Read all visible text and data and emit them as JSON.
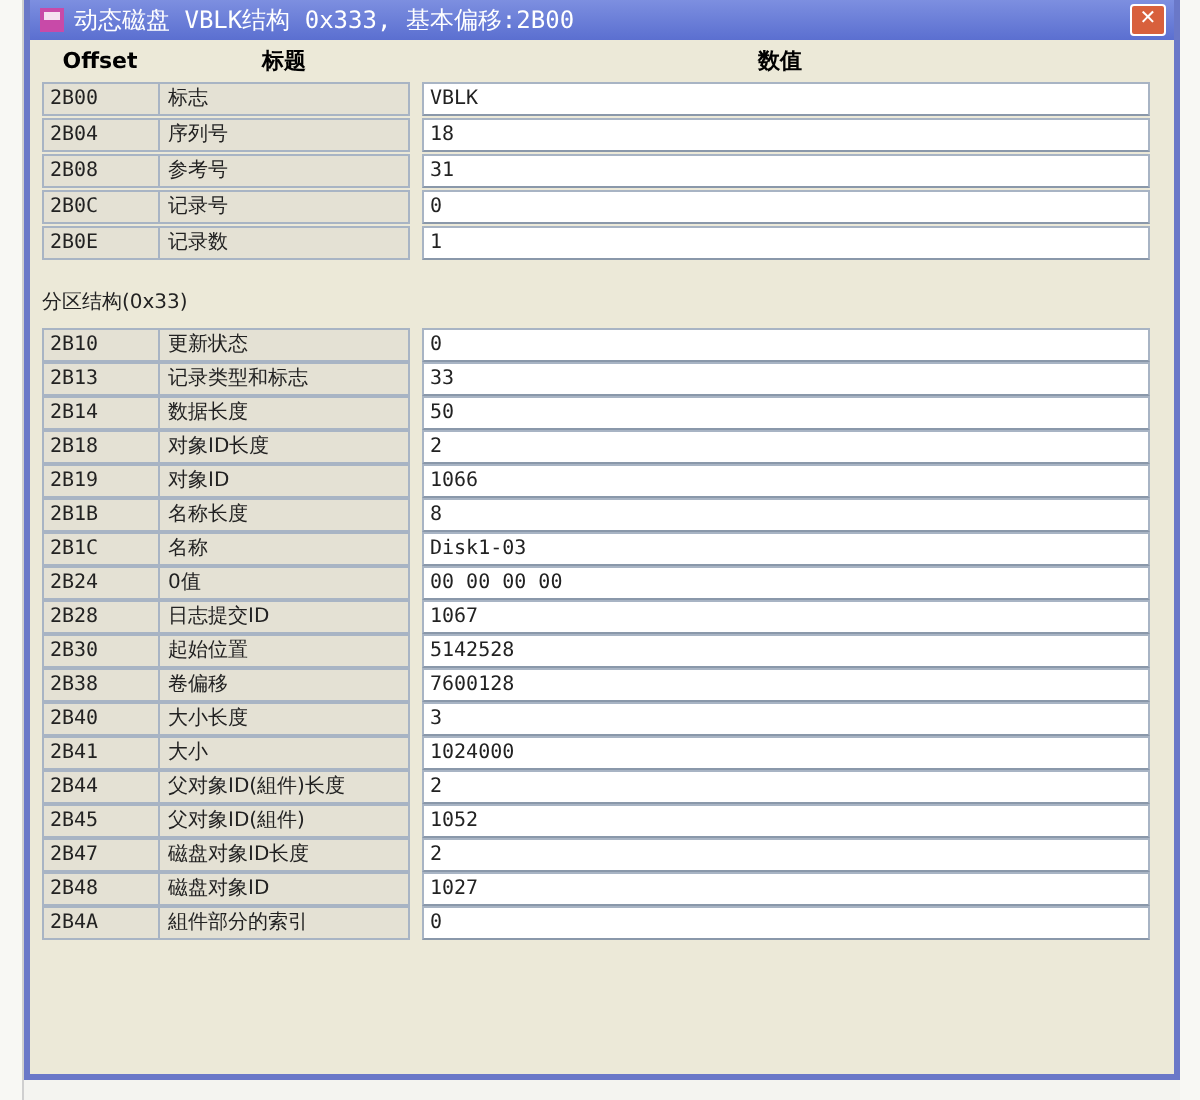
{
  "window": {
    "title": "动态磁盘 VBLK结构 0x333, 基本偏移:2B00",
    "close": "✕"
  },
  "columns": [
    "Offset",
    "标题",
    "数值"
  ],
  "header_rows": [
    {
      "offset": "2B00",
      "title": "标志",
      "value": "VBLK"
    },
    {
      "offset": "2B04",
      "title": "序列号",
      "value": "18"
    },
    {
      "offset": "2B08",
      "title": "参考号",
      "value": "31"
    },
    {
      "offset": "2B0C",
      "title": "记录号",
      "value": "0"
    },
    {
      "offset": "2B0E",
      "title": "记录数",
      "value": "1"
    }
  ],
  "section": {
    "title": "分区结构(0x33)",
    "rows": [
      {
        "offset": "2B10",
        "title": "更新状态",
        "value": "0"
      },
      {
        "offset": "2B13",
        "title": "记录类型和标志",
        "value": "33"
      },
      {
        "offset": "2B14",
        "title": "数据长度",
        "value": "50"
      },
      {
        "offset": "2B18",
        "title": "对象ID长度",
        "value": "2"
      },
      {
        "offset": "2B19",
        "title": "对象ID",
        "value": "1066"
      },
      {
        "offset": "2B1B",
        "title": "名称长度",
        "value": "8"
      },
      {
        "offset": "2B1C",
        "title": "名称",
        "value": "Disk1-03"
      },
      {
        "offset": "2B24",
        "title": "0值",
        "value": "00 00 00 00"
      },
      {
        "offset": "2B28",
        "title": "日志提交ID",
        "value": "1067"
      },
      {
        "offset": "2B30",
        "title": "起始位置",
        "value": "5142528"
      },
      {
        "offset": "2B38",
        "title": "卷偏移",
        "value": "7600128"
      },
      {
        "offset": "2B40",
        "title": "大小长度",
        "value": "3"
      },
      {
        "offset": "2B41",
        "title": "大小",
        "value": "1024000"
      },
      {
        "offset": "2B44",
        "title": "父对象ID(組件)长度",
        "value": "2"
      },
      {
        "offset": "2B45",
        "title": "父对象ID(組件)",
        "value": "1052"
      },
      {
        "offset": "2B47",
        "title": "磁盘对象ID长度",
        "value": "2"
      },
      {
        "offset": "2B48",
        "title": "磁盘对象ID",
        "value": "1027"
      },
      {
        "offset": "2B4A",
        "title": "組件部分的索引",
        "value": "0"
      }
    ]
  }
}
